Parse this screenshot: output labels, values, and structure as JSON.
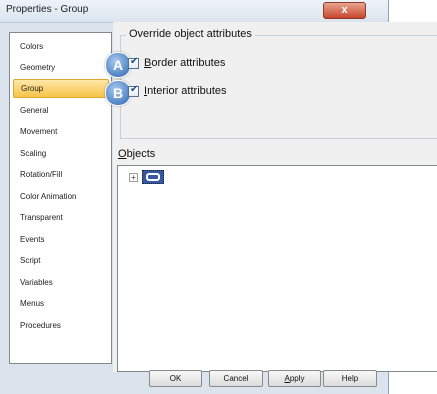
{
  "window": {
    "title": "Properties - Group",
    "close_glyph": "x"
  },
  "sidebar": {
    "items": [
      {
        "label": "Colors"
      },
      {
        "label": "Geometry"
      },
      {
        "label": "Group",
        "selected": true
      },
      {
        "label": "General"
      },
      {
        "label": "Movement"
      },
      {
        "label": "Scaling"
      },
      {
        "label": "Rotation/Fill"
      },
      {
        "label": "Color Animation"
      },
      {
        "label": "Transparent"
      },
      {
        "label": "Events"
      },
      {
        "label": "Script"
      },
      {
        "label": "Variables"
      },
      {
        "label": "Menus"
      },
      {
        "label": "Procedures"
      }
    ]
  },
  "override": {
    "title": "Override object attributes",
    "border": {
      "mnemonic": "B",
      "rest": "order attributes",
      "checked": true,
      "badge": "A"
    },
    "interior": {
      "mnemonic": "I",
      "rest": "nterior attributes",
      "checked": true,
      "badge": "B"
    }
  },
  "objects": {
    "mnemonic": "O",
    "rest": "bjects",
    "expander": "+"
  },
  "buttons": {
    "ok": "OK",
    "cancel": "Cancel",
    "apply_mnemonic": "A",
    "apply_rest": "pply",
    "help": "Help"
  },
  "colors": {
    "selected_item": "#f7c34a",
    "badge": "#4f83c4",
    "close_button": "#c7452b"
  }
}
